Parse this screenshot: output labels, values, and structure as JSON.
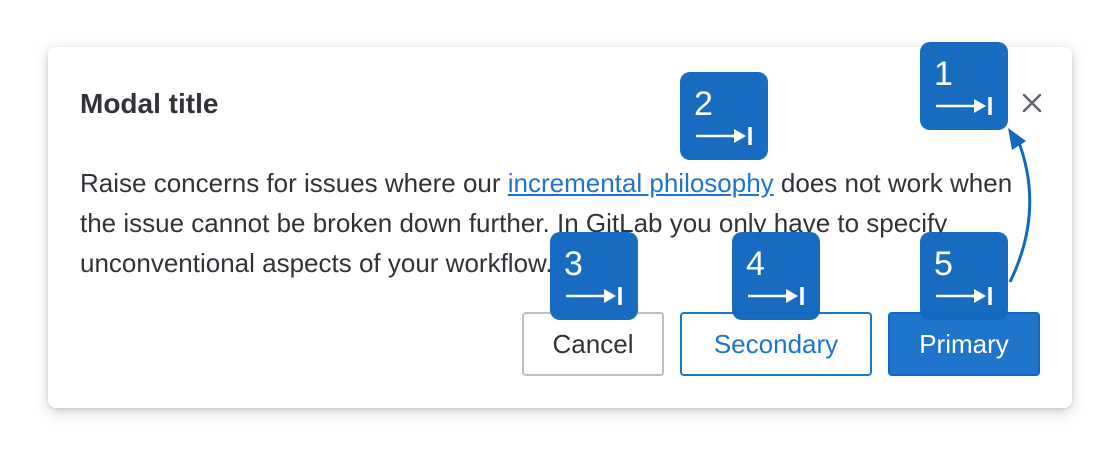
{
  "modal": {
    "title": "Modal title",
    "close_icon": "close-icon",
    "body_before_link": "Raise concerns for issues where our ",
    "body_link": "incremental philosophy",
    "body_after_link": " does not work when the issue cannot be broken down further. In GitLab you only have to specify unconventional aspects of your workflow."
  },
  "buttons": {
    "cancel": "Cancel",
    "secondary": "Secondary",
    "primary": "Primary"
  },
  "focus_order": {
    "icon": "tab-key-icon",
    "color": "#1068bf",
    "steps": [
      "1",
      "2",
      "3",
      "4",
      "5"
    ]
  },
  "colors": {
    "primary": "#1f75cb",
    "text": "#333238",
    "badge": "#1068bf"
  }
}
